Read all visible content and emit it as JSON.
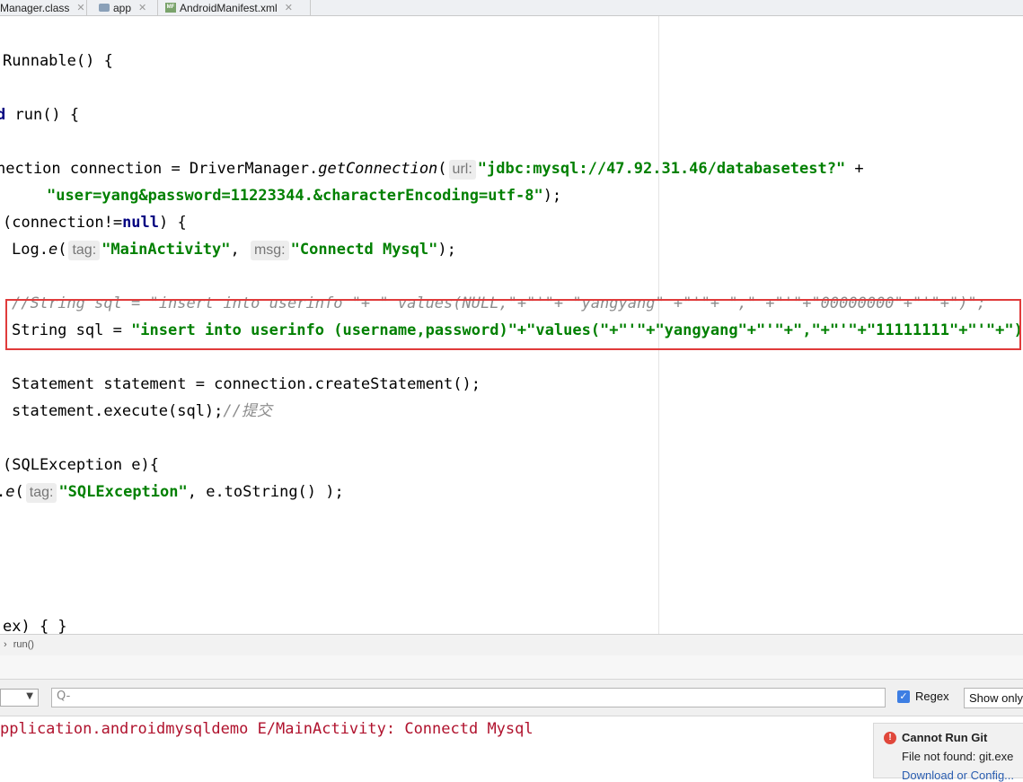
{
  "tabs": [
    {
      "label": "Manager.class",
      "close": "✕"
    },
    {
      "label": "app",
      "close": "✕"
    },
    {
      "label": "AndroidManifest.xml",
      "close": "✕"
    }
  ],
  "code": {
    "l1": "Runnable() {",
    "l2a": "d",
    "l2b": " run() {",
    "l3a": "nection connection = DriverManager.",
    "l3b": "getConnection",
    "l3c": "(",
    "l3hint": "url:",
    "l3str": "\"jdbc:mysql://47.92.31.46/databasetest?\"",
    "l3d": " +",
    "l4str": "\"user=yang&password=11223344.&characterEncoding=utf-8\"",
    "l4b": ");",
    "l5a": "(connection!=",
    "l5kw": "null",
    "l5b": ") {",
    "l6a": "Log.",
    "l6b": "e",
    "l6c": "(",
    "l6hint1": "tag:",
    "l6str1": "\"MainActivity\"",
    "l6d": ",",
    "l6hint2": "msg:",
    "l6str2": "\"Connectd Mysql\"",
    "l6e": ");",
    "l7": "//String sql = \"insert into userinfo \"+ \" values(NULL,\"+\"'\"+ \"yangyang\" +\"'\"+ \",\" +\"'\"+\"00000000\"+\"'\"+\")\";",
    "l8a": "String sql = ",
    "l8str": "\"insert into userinfo (username,password)\"+\"values(\"+\"'\"+\"yangyang\"+\"'\"+\",\"+\"'\"+\"11111111\"+\"'\"+\")\"",
    "l8b": ";",
    "l9": "Statement statement = connection.createStatement();",
    "l10a": "statement.execute(sql);",
    "l10cmt": "//提交",
    "l11": "(SQLException e){",
    "l12a": ".",
    "l12b": "e",
    "l12c": "(",
    "l12hint": "tag:",
    "l12str": "\"SQLException\"",
    "l12d": ", e.toString() );",
    "l13": "ex) { }"
  },
  "breadcrumb": {
    "arrow": "›",
    "item": "run()"
  },
  "logcat": {
    "search_icon": "Q-",
    "regex_check": "✓",
    "regex_label": "Regex",
    "show_only": "Show only",
    "dropdown_arrow": "▼",
    "log_line": "pplication.androidmysqldemo E/MainActivity: Connectd Mysql"
  },
  "notification": {
    "icon": "!",
    "title": "Cannot Run Git",
    "body": "File not found: git.exe",
    "link": "Download or Config..."
  },
  "colors": {
    "keyword": "#000080",
    "string": "#008000",
    "comment": "#8c8c8c",
    "log_error": "#b0122d",
    "highlight_border": "#e03b3b"
  }
}
